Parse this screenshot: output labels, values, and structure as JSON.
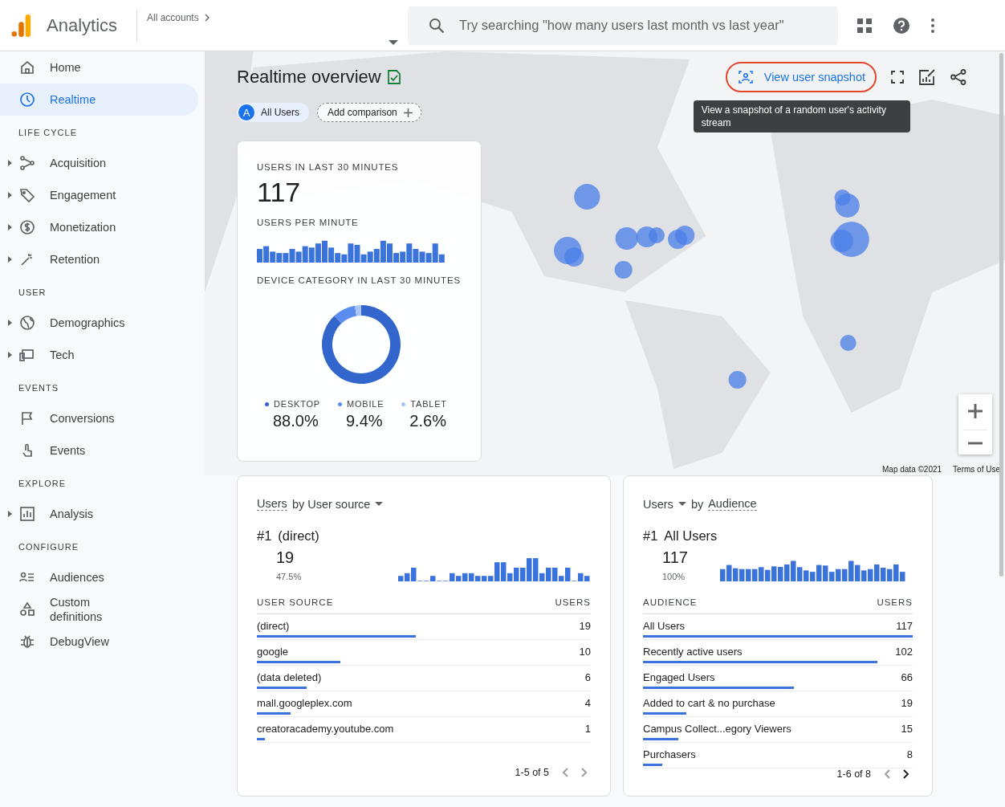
{
  "header": {
    "product": "Analytics",
    "breadcrumb": "All accounts",
    "search_placeholder": "Try searching \"how many users last month vs last year\""
  },
  "sidebar": {
    "groups": [
      {
        "items": [
          {
            "label": "Home",
            "expandable": false,
            "selected": false
          },
          {
            "label": "Realtime",
            "expandable": false,
            "selected": true
          }
        ]
      },
      {
        "title": "LIFE CYCLE",
        "items": [
          {
            "label": "Acquisition",
            "expandable": true,
            "selected": false
          },
          {
            "label": "Engagement",
            "expandable": true,
            "selected": false
          },
          {
            "label": "Monetization",
            "expandable": true,
            "selected": false
          },
          {
            "label": "Retention",
            "expandable": true,
            "selected": false
          }
        ]
      },
      {
        "title": "USER",
        "items": [
          {
            "label": "Demographics",
            "expandable": true,
            "selected": false
          },
          {
            "label": "Tech",
            "expandable": true,
            "selected": false
          }
        ]
      },
      {
        "title": "EVENTS",
        "items": [
          {
            "label": "Conversions",
            "expandable": false,
            "selected": false
          },
          {
            "label": "Events",
            "expandable": false,
            "selected": false
          }
        ]
      },
      {
        "title": "EXPLORE",
        "items": [
          {
            "label": "Analysis",
            "expandable": true,
            "selected": false
          }
        ]
      },
      {
        "title": "CONFIGURE",
        "items": [
          {
            "label": "Audiences",
            "expandable": false,
            "selected": false
          },
          {
            "label": "Custom definitions",
            "expandable": false,
            "selected": false
          },
          {
            "label": "DebugView",
            "expandable": false,
            "selected": false
          }
        ]
      }
    ]
  },
  "page": {
    "title": "Realtime overview",
    "comparison": {
      "badge": "A",
      "label": "All Users"
    },
    "add_comparison": "Add comparison",
    "snapshot_button": "View user snapshot",
    "tooltip": "View a snapshot of a random user's activity stream"
  },
  "realtime_card": {
    "users_title": "USERS IN LAST 30 MINUTES",
    "users_value": "117",
    "per_minute_title": "USERS PER MINUTE",
    "device_title": "DEVICE CATEGORY IN LAST 30 MINUTES",
    "chart_data": {
      "type": "donut",
      "categories": [
        "DESKTOP",
        "MOBILE",
        "TABLET"
      ],
      "values": [
        88.0,
        9.4,
        2.6
      ]
    },
    "devices": [
      {
        "value": "88.0%",
        "color": "#3366cc"
      },
      {
        "value": "9.4%",
        "color": "#5b8def"
      },
      {
        "value": "2.6%",
        "color": "#a8c4f8"
      }
    ]
  },
  "map": {
    "attribution": "Map data ©2021",
    "terms": "Terms of Use"
  },
  "cards": [
    {
      "title_parts": [
        {
          "text": "Users",
          "dashed": true,
          "dropdown": false
        },
        {
          "text": "by User source",
          "dashed": false,
          "dropdown": true
        }
      ],
      "top_rank": "#1",
      "top_name": "(direct)",
      "top_value": "19",
      "top_share": "47.5%",
      "column_1": "USER SOURCE",
      "column_2": "USERS",
      "rows": [
        {
          "name": "(direct)",
          "value": "19",
          "level": 0.475
        },
        {
          "name": "google",
          "value": "10",
          "level": 0.25
        },
        {
          "name": "(data deleted)",
          "value": "6",
          "level": 0.15
        },
        {
          "name": "mall.googleplex.com",
          "value": "4",
          "level": 0.1
        },
        {
          "name": "creatoracademy.youtube.com",
          "value": "1",
          "level": 0.025
        }
      ],
      "pager": {
        "label": "1-5 of 5",
        "prev_disabled": true,
        "next_disabled": true
      }
    },
    {
      "title_parts": [
        {
          "text": "Users",
          "dashed": false,
          "dropdown": true
        },
        {
          "text": "by",
          "dashed": false,
          "dropdown": false
        },
        {
          "text": "Audience",
          "dashed": true,
          "dropdown": false
        }
      ],
      "top_rank": "#1",
      "top_name": "All Users",
      "top_value": "117",
      "top_share": "100%",
      "column_1": "AUDIENCE",
      "column_2": "USERS",
      "rows": [
        {
          "name": "All Users",
          "value": "117",
          "level": 1
        },
        {
          "name": "Recently active users",
          "value": "102",
          "level": 0.87
        },
        {
          "name": "Engaged Users",
          "value": "66",
          "level": 0.56
        },
        {
          "name": "Added to cart & no purchase",
          "value": "19",
          "level": 0.16
        },
        {
          "name": "Campus Collect...egory Viewers",
          "value": "15",
          "level": 0.13
        },
        {
          "name": "Purchasers",
          "value": "8",
          "level": 0.07
        }
      ],
      "pager": {
        "label": "1-6 of 8",
        "prev_disabled": true,
        "next_disabled": false
      }
    }
  ]
}
